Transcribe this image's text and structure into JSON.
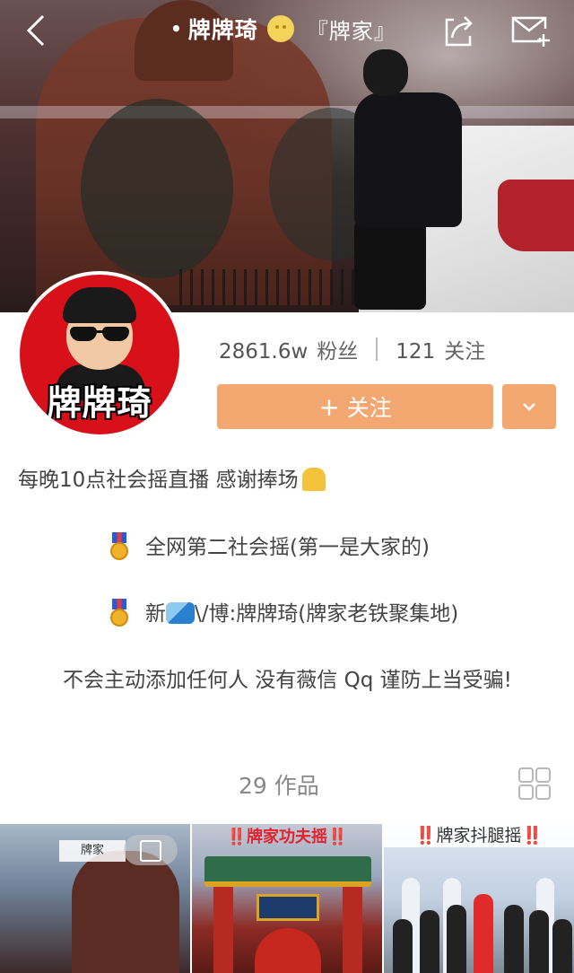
{
  "header": {
    "title_dot": "•",
    "title": "牌牌琦",
    "title_suffix": "『牌家』",
    "icons": {
      "back": "chevron-left-icon",
      "share": "share-icon",
      "message": "mail-add-icon"
    }
  },
  "avatar": {
    "text": "牌牌琦"
  },
  "stats": {
    "fans_count": "2861.6w",
    "fans_label": "粉丝",
    "following_count": "121",
    "following_label": "关注"
  },
  "actions": {
    "follow_icon": "+",
    "follow_label": "关注",
    "more_icon": "chevron-down-icon",
    "accent_color": "#f2a870"
  },
  "bio": {
    "line1": "每晚10点社会摇直播 感谢捧场",
    "line2": "全网第二社会摇(第一是大家的)",
    "line3_prefix": "新",
    "line3_suffix": "\\/博:牌牌琦(牌家老铁聚集地)",
    "line4": "不会主动添加任何人 没有薇信 Qq 谨防上当受骗!"
  },
  "works": {
    "count": "29",
    "label": "作品",
    "thumbnails": [
      {
        "label": "牌家"
      },
      {
        "label": "‼️牌家功夫摇‼️"
      },
      {
        "label": "牌家抖腿摇"
      }
    ]
  }
}
